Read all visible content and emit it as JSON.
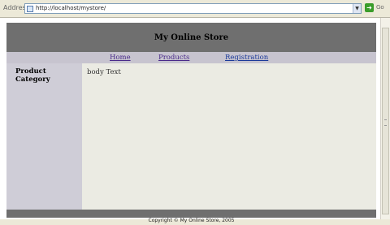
{
  "browser": {
    "address_label": "Address",
    "url": "http://localhost/mystore/",
    "go_label": "Go"
  },
  "site": {
    "title": "My Online Store",
    "nav": [
      "Home",
      "Products",
      "Registration"
    ],
    "sidebar_heading": "Product Category",
    "body_text": "body Text",
    "footer": "Copyright © My Online Store, 2005"
  }
}
